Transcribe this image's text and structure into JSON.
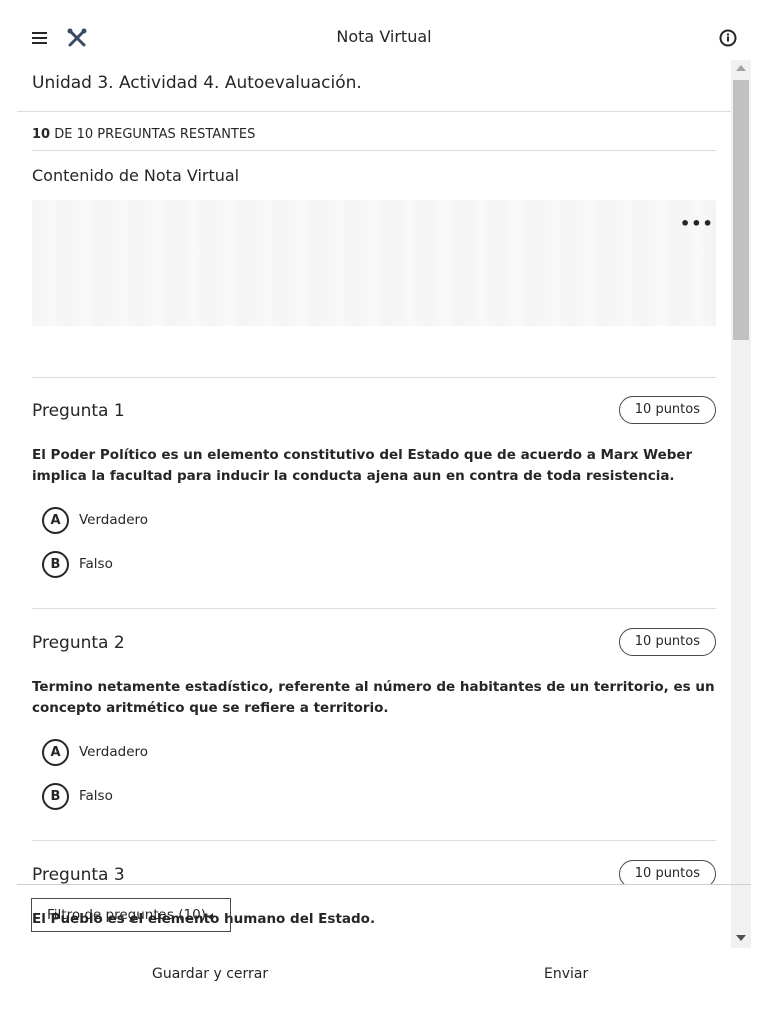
{
  "app": {
    "title": "Nota Virtual",
    "icons": {
      "menu": "hamburger-menu-icon",
      "close": "crossed-tools-icon",
      "info": "info-circle-icon"
    }
  },
  "assessment": {
    "heading": "Unidad 3. Actividad 4. Autoevaluación.",
    "remaining_count": "10",
    "remaining_rest": " DE 10 PREGUNTAS RESTANTES",
    "content_title": "Contenido de Nota Virtual",
    "more_label": "•••"
  },
  "questions": [
    {
      "title": "Pregunta 1",
      "points": "10 puntos",
      "text": "El Poder Político es un elemento constitutivo del Estado que de acuerdo a Marx Weber implica la facultad para inducir la conducta ajena aun en contra de toda resistencia.",
      "options": [
        {
          "letter": "A",
          "label": "Verdadero"
        },
        {
          "letter": "B",
          "label": "Falso"
        }
      ]
    },
    {
      "title": "Pregunta 2",
      "points": "10 puntos",
      "text": "Termino netamente estadístico, referente al número de habitantes de un territorio, es un concepto aritmético que se refiere a territorio.",
      "options": [
        {
          "letter": "A",
          "label": "Verdadero"
        },
        {
          "letter": "B",
          "label": "Falso"
        }
      ]
    },
    {
      "title": "Pregunta 3",
      "points": "10 puntos",
      "text": "El Pueblo es el elemento humano del Estado."
    }
  ],
  "footer": {
    "filter_label": "Filtro de preguntas (10)",
    "save_label": "Guardar y cerrar",
    "submit_label": "Enviar"
  }
}
